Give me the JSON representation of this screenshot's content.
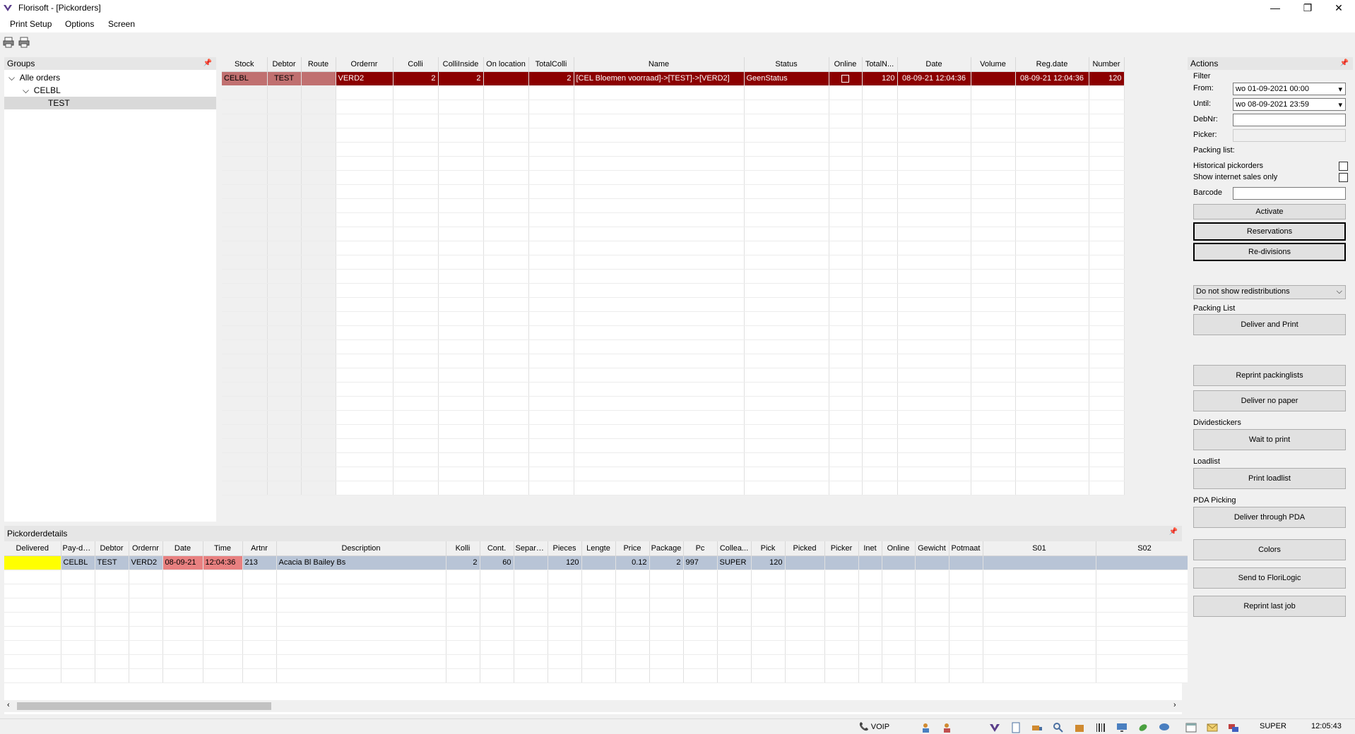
{
  "window": {
    "title": "Florisoft - [Pickorders]",
    "min": "—",
    "max": "❐",
    "close": "✕"
  },
  "menu": [
    "Print Setup",
    "Options",
    "Screen"
  ],
  "groups": {
    "title": "Groups",
    "tree": [
      {
        "label": "Alle orders",
        "expanded": true
      },
      {
        "label": "CELBL",
        "expanded": true
      },
      {
        "label": "TEST",
        "selected": true
      }
    ]
  },
  "orders": {
    "columns": [
      "Stock",
      "Debtor",
      "Route",
      "Ordernr",
      "Colli",
      "ColliInside",
      "On location",
      "TotalColli",
      "Name",
      "Status",
      "Online",
      "TotalN...",
      "Date",
      "Volume",
      "Reg.date",
      "Number"
    ],
    "rows": [
      {
        "Stock": "CELBL",
        "Debtor": "TEST",
        "Route": "",
        "Ordernr": "VERD2",
        "Colli": "2",
        "ColliInside": "2",
        "OnLocation": "",
        "TotalColli": "2",
        "Name": "[CEL Bloemen voorraad]->[TEST]->[VERD2]",
        "Status": "GeenStatus",
        "Online": false,
        "TotalN": "120",
        "Date": "08-09-21 12:04:36",
        "Volume": "",
        "RegDate": "08-09-21 12:04:36",
        "Number": "120"
      }
    ]
  },
  "details": {
    "title": "Pickorderdetails",
    "columns": [
      "Delivered",
      "Pay-desk",
      "Debtor",
      "Ordernr",
      "Date",
      "Time",
      "Artnr",
      "Description",
      "Kolli",
      "Cont.",
      "Separate",
      "Pieces",
      "Lengte",
      "Price",
      "Package",
      "Pc",
      "Collea...",
      "Pick",
      "Picked",
      "Picker",
      "Inet",
      "Online",
      "Gewicht",
      "Potmaat",
      "S01",
      "S02"
    ],
    "rows": [
      {
        "Delivered": "",
        "PayDesk": "CELBL",
        "Debtor": "TEST",
        "Ordernr": "VERD2",
        "Date": "08-09-21",
        "Time": "12:04:36",
        "Artnr": "213",
        "Description": "Acacia Bl Bailey Bs",
        "Kolli": "2",
        "Cont": "60",
        "Separate": "",
        "Pieces": "120",
        "Lengte": "",
        "Price": "0.12",
        "Package": "2",
        "Pc": "997",
        "Collea": "SUPER",
        "Pick": "120",
        "Picked": "",
        "Picker": ""
      }
    ]
  },
  "actions": {
    "title": "Actions",
    "filter_title": "Filter",
    "from_label": "From:",
    "from_value": "wo 01-09-2021 00:00",
    "until_label": "Until:",
    "until_value": "wo 08-09-2021 23:59",
    "debnr_label": "DebNr:",
    "picker_label": "Picker:",
    "packing_list_label": "Packing list:",
    "historical_label": "Historical pickorders",
    "internet_label": "Show internet sales only",
    "barcode_label": "Barcode",
    "activate": "Activate",
    "reservations": "Reservations",
    "redivisions": "Re-divisions",
    "redistrib_select": "Do not show redistributions",
    "packing_list_title": "Packing List",
    "deliver_print": "Deliver and Print",
    "reprint_packinglists": "Reprint packinglists",
    "deliver_no_paper": "Deliver no paper",
    "dividestickers_title": "Dividestickers",
    "wait_to_print": "Wait to print",
    "loadlist_title": "Loadlist",
    "print_loadlist": "Print loadlist",
    "pda_title": "PDA Picking",
    "deliver_pda": "Deliver through PDA",
    "colors": "Colors",
    "send_florilogic": "Send to FloriLogic",
    "reprint_last_job": "Reprint last job"
  },
  "status": {
    "voip": "VOIP",
    "user": "SUPER",
    "time": "12:05:43"
  },
  "colors": {
    "selected_row": "#8b0000",
    "pink_cell": "#c07070",
    "delivered_yellow": "#ffff00",
    "date_red": "#e88080"
  }
}
